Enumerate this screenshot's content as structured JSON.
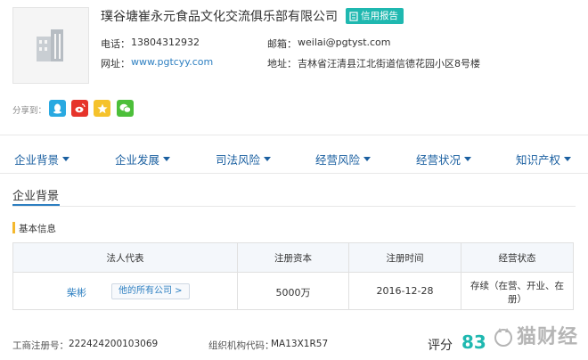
{
  "company": {
    "name": "璞谷塘崔永元食品文化交流俱乐部有限公司",
    "credit_report_label": "信用报告"
  },
  "contact": {
    "phone_label": "电话：",
    "phone": "13804312932",
    "email_label": "邮箱：",
    "email": "weilai@pgtyst.com",
    "website_label": "网址：",
    "website": "www.pgtcyy.com",
    "address_label": "地址：",
    "address": "吉林省汪清县江北街道信德花园小区8号楼"
  },
  "share": {
    "label": "分享到：",
    "colors": {
      "qq": "#29a9e1",
      "weibo": "#e6342b",
      "qzone": "#f5c22b",
      "wechat": "#4cbf3a"
    }
  },
  "nav": {
    "items": [
      {
        "label": "企业背景"
      },
      {
        "label": "企业发展"
      },
      {
        "label": "司法风险"
      },
      {
        "label": "经营风险"
      },
      {
        "label": "经营状况"
      },
      {
        "label": "知识产权"
      }
    ]
  },
  "section": {
    "title": "企业背景",
    "subhead": "基本信息"
  },
  "basic_info": {
    "headers": [
      "法人代表",
      "注册资本",
      "注册时间",
      "经营状态"
    ],
    "legal_rep": "柴彬",
    "all_companies_label": "他的所有公司 >",
    "capital": "5000万",
    "reg_date": "2016-12-28",
    "status_line1": "存续（在营、开业、在",
    "status_line2": "册）"
  },
  "footer": {
    "reg_no_label": "工商注册号：",
    "reg_no": "222424200103069",
    "org_code_label": "组织机构代码：",
    "org_code": "MA13X1R57",
    "score_label": "评分",
    "score": "83",
    "watermark": "猫财经"
  },
  "colors": {
    "accent": "#1fb8b0",
    "link": "#2d7fc1",
    "nav": "#1a5fa0"
  }
}
